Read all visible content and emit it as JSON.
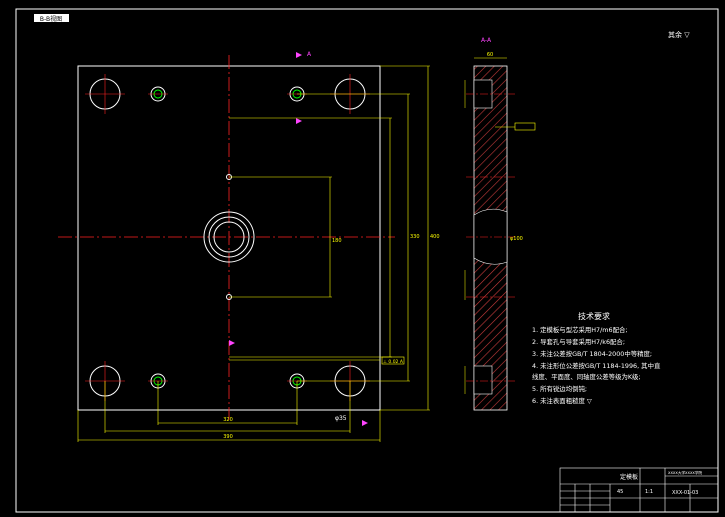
{
  "drawing": {
    "tag": "B-B视图",
    "section_label_top": "A",
    "section_label_view": "A-A",
    "roughness_note": "其余 ▽",
    "tech_requirements": {
      "title": "技术要求",
      "items": [
        "1. 定模板与型芯采用H7/m6配合;",
        "2. 导套孔与导套采用H7/k6配合;",
        "3. 未注公差按GB/T 1804-2000中等精度;",
        "4. 未注形位公差按GB/T 1184-1996, 其中直",
        "   线度、平面度、同轴度公差等级为K级;",
        "5. 所有锐边均倒钝;",
        "6. 未注表面粗糙度 ▽"
      ]
    },
    "title_block": {
      "part_name": "定模板",
      "school": "XXXX大学XXXX学院",
      "material": "45",
      "scale": "1:1",
      "drawing_no": "XXX-01-03"
    },
    "dims": {
      "width_total": "390",
      "width_inner": "320",
      "height_total": "400",
      "height_inner": "330",
      "pocket": "180",
      "thickness": "60",
      "hole": "φ35",
      "bore": "φ100",
      "tol_note": "⊥ 0.02 A"
    }
  },
  "colors": {
    "background": "#000000",
    "outline": "#ffffff",
    "center": "#ff2222",
    "dimension": "#ffff00",
    "hatch": "#c83c3c",
    "accent": "#00ff00",
    "magenta": "#ff44ff"
  }
}
